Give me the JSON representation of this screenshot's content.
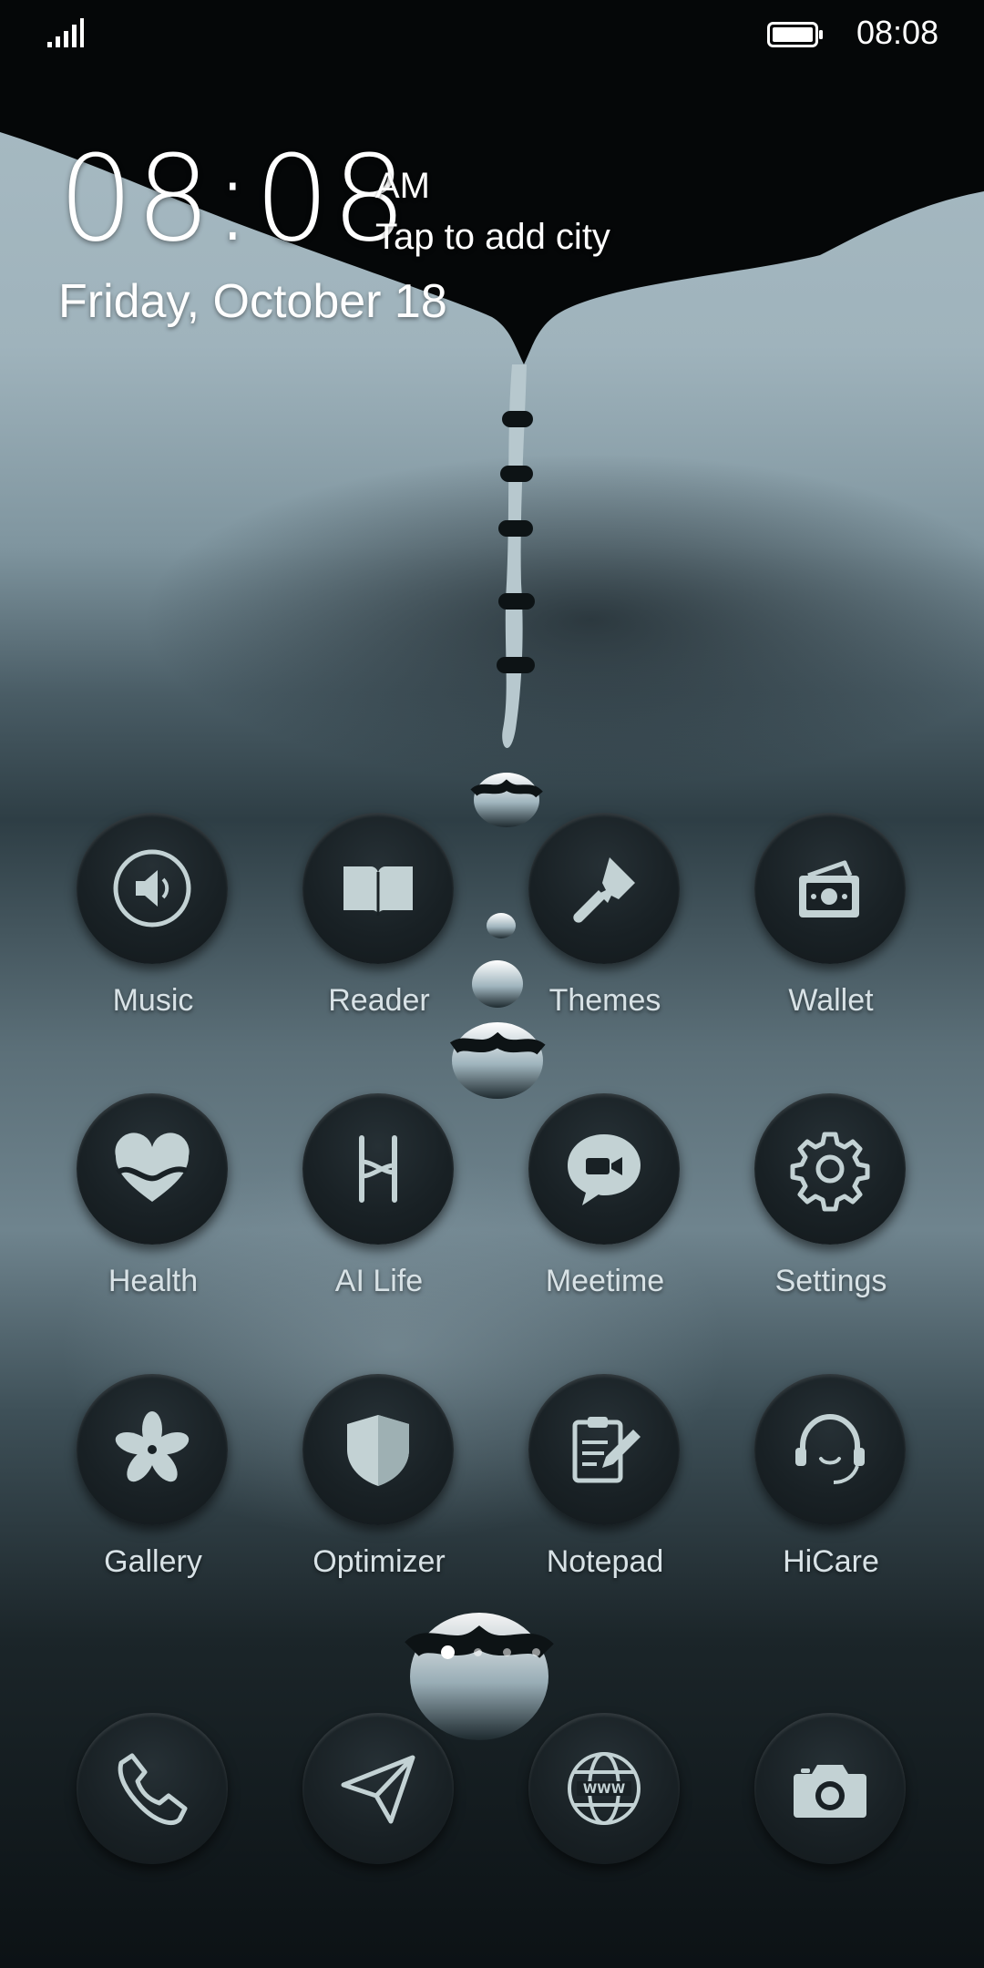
{
  "status_bar": {
    "time": "08:08",
    "icons": [
      "signal-icon",
      "battery-icon"
    ]
  },
  "clock_widget": {
    "time": "08:08",
    "ampm": "AM",
    "city_prompt": "Tap to add city",
    "date": "Friday, October 18"
  },
  "apps": [
    {
      "label": "Music",
      "icon": "speaker-icon"
    },
    {
      "label": "Reader",
      "icon": "book-icon"
    },
    {
      "label": "Themes",
      "icon": "paintbrush-icon"
    },
    {
      "label": "Wallet",
      "icon": "wallet-icon"
    },
    {
      "label": "Health",
      "icon": "heart-icon"
    },
    {
      "label": "AI Life",
      "icon": "ai-life-icon"
    },
    {
      "label": "Meetime",
      "icon": "video-chat-icon"
    },
    {
      "label": "Settings",
      "icon": "gear-icon"
    },
    {
      "label": "Gallery",
      "icon": "flower-icon"
    },
    {
      "label": "Optimizer",
      "icon": "shield-icon"
    },
    {
      "label": "Notepad",
      "icon": "notepad-icon"
    },
    {
      "label": "HiCare",
      "icon": "headset-icon"
    }
  ],
  "page_indicator": {
    "total": 4,
    "current": 1
  },
  "dock": [
    {
      "icon": "phone-icon"
    },
    {
      "icon": "send-icon"
    },
    {
      "icon": "globe-icon"
    },
    {
      "icon": "camera-icon"
    }
  ],
  "colors": {
    "icon_fill": "#c3d2d4",
    "icon_bg": "#192125",
    "label": "#d8e2e6"
  }
}
